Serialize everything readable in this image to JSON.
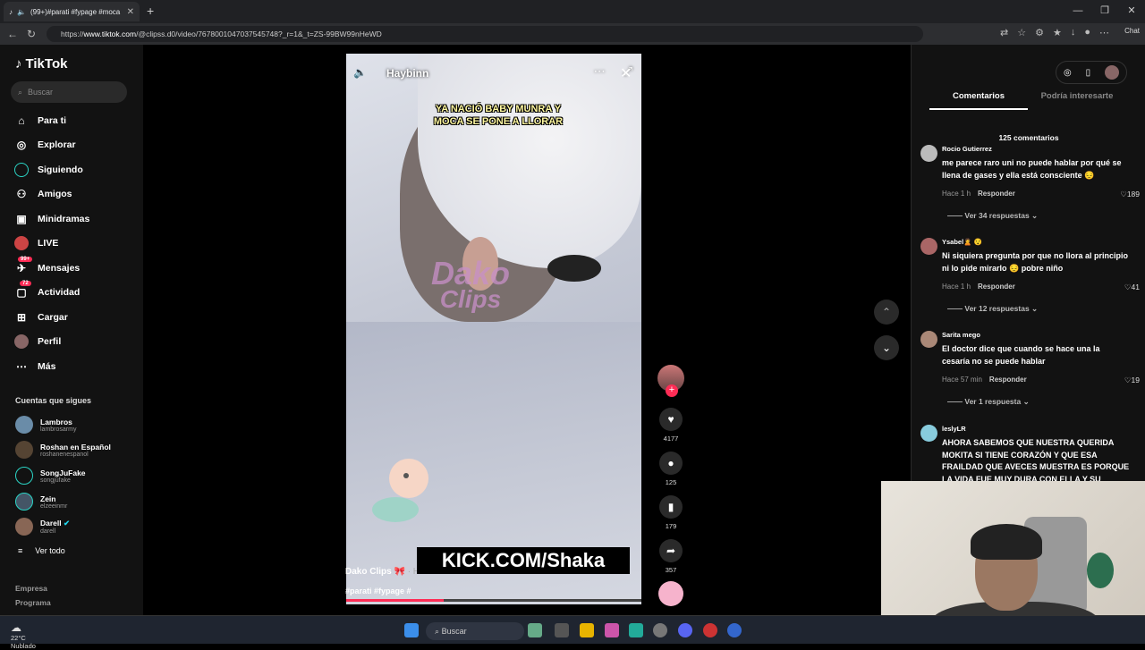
{
  "browser": {
    "tab_title": "(99+)#parati #fypage #moca",
    "url_prefix": "https://",
    "url_domain": "www.tiktok.com",
    "url_rest": "/@clipss.d0/video/7678001047037545748?_r=1&_t=ZS-99BW99nHeWD",
    "chat_label": "Chat"
  },
  "sidebar": {
    "logo": "TikTok",
    "search_placeholder": "Buscar",
    "nav": [
      {
        "label": "Para ti",
        "icon": "home-icon"
      },
      {
        "label": "Explorar",
        "icon": "compass-icon"
      },
      {
        "label": "Siguiendo",
        "icon": "following-icon"
      },
      {
        "label": "Amigos",
        "icon": "friends-icon"
      },
      {
        "label": "Minidramas",
        "icon": "drama-icon"
      },
      {
        "label": "LIVE",
        "icon": "live-icon"
      },
      {
        "label": "Mensajes",
        "icon": "message-icon",
        "badge": "99+"
      },
      {
        "label": "Actividad",
        "icon": "activity-icon",
        "badge": "72"
      },
      {
        "label": "Cargar",
        "icon": "upload-icon"
      },
      {
        "label": "Perfil",
        "icon": "profile-icon"
      },
      {
        "label": "Más",
        "icon": "more-icon"
      }
    ],
    "following_title": "Cuentas que sigues",
    "following": [
      {
        "name": "Lambros",
        "handle": "lambrosarmy"
      },
      {
        "name": "Roshan en Español",
        "handle": "roshanenespanol"
      },
      {
        "name": "SongJuFake",
        "handle": "songjufake"
      },
      {
        "name": "Zein",
        "handle": "elzeeinmr"
      },
      {
        "name": "Darell",
        "handle": "darell"
      }
    ],
    "see_all": "Ver todo",
    "footer": [
      "Empresa",
      "Programa"
    ]
  },
  "video": {
    "channel": "Haybinn",
    "caption": "YA NACIÓ BABY MUNRA Y MOCA SE PONE A LLORAR",
    "watermark_line1": "Dako",
    "watermark_line2": "Clips",
    "author": "Dako Clips 🎀",
    "time": " · Hace 2 h",
    "tags": "#parati #fypage #",
    "overlay": "KICK.COM/Shaka",
    "progress": 0.33
  },
  "actions": {
    "likes": "4177",
    "comments": "125",
    "saves": "179",
    "shares": "357"
  },
  "panel": {
    "tab_comments": "Comentarios",
    "tab_interest": "Podría interesarte",
    "count": "125 comentarios",
    "comments": [
      {
        "user": "Rocio Gutierrez",
        "text": "me parece raro uni no puede hablar por qué se llena de gases y ella está consciente 😔",
        "time": "Hace 1 h",
        "reply": "Responder",
        "likes": "189",
        "more": "Ver 34 respuestas"
      },
      {
        "user": "Ysabel🙎 😯",
        "text": "Ni siquiera pregunta por que no llora al principio ni lo pide mirarlo 😔 pobre niño",
        "time": "Hace 1 h",
        "reply": "Responder",
        "likes": "41",
        "more": "Ver 12 respuestas"
      },
      {
        "user": "Sarita mego",
        "text": "El doctor dice que cuando se hace una la cesaría no se puede hablar",
        "time": "Hace 57 min",
        "reply": "Responder",
        "likes": "19",
        "more": "Ver 1 respuesta"
      },
      {
        "user": "leslyLR",
        "text": "AHORA SABEMOS QUE NUESTRA QUERIDA MOKITA SI TIENE CORAZÓN Y QUE ESA FRAILDAD QUE AVECES MUESTRA ES PORQUE LA VIDA FUE MUY DURA CON ELLA Y SU"
      }
    ]
  },
  "taskbar": {
    "temp": "22°C",
    "weather": "Nublado",
    "search": "Buscar"
  }
}
